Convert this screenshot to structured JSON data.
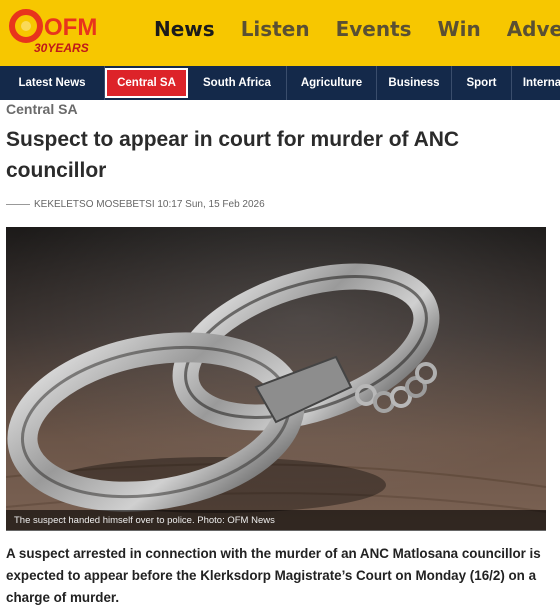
{
  "brand": {
    "logo_letters": "OFM",
    "logo_tagline": "30YEARS",
    "brand_color": "#f7c700",
    "accent_color": "#e8341c",
    "nav_bg_color": "#14294a",
    "active_tab_color": "#dd2329"
  },
  "top_nav": [
    "News",
    "Listen",
    "Events",
    "Win",
    "Adver"
  ],
  "section_nav": [
    {
      "label": "Latest News",
      "active": false
    },
    {
      "label": "Central SA",
      "active": true
    },
    {
      "label": "South Africa",
      "active": false
    },
    {
      "label": "Agriculture",
      "active": false
    },
    {
      "label": "Business",
      "active": false
    },
    {
      "label": "Sport",
      "active": false
    },
    {
      "label": "Interna",
      "active": false
    }
  ],
  "article": {
    "category": "Central SA",
    "title": "Suspect to appear in court for murder of ANC councillor",
    "byline": "KEKELETSO MOSEBETSI 10:17 Sun, 15 Feb 2026",
    "image_subject": "handcuffs",
    "image_caption": "The suspect handed himself over to police. Photo: OFM News",
    "lead": "A suspect arrested in connection with the murder of an ANC Matlosana councillor is expected to appear before the Klerksdorp Magistrate’s Court on Monday (16/2) on a charge of murder."
  }
}
